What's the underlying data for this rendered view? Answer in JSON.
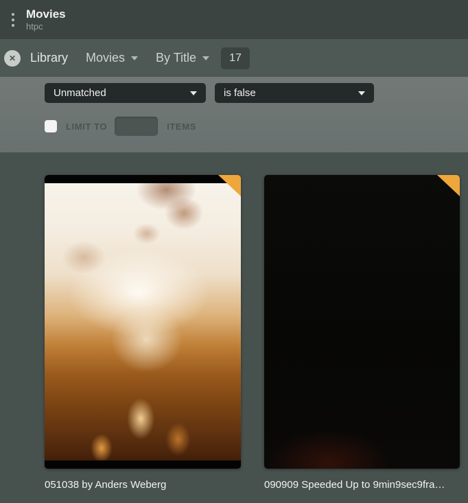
{
  "titlebar": {
    "title": "Movies",
    "subtitle": "htpc"
  },
  "nav": {
    "library_label": "Library",
    "type_dropdown_label": "Movies",
    "sort_dropdown_label": "By Title",
    "count_badge": "17"
  },
  "filters": {
    "field_value": "Unmatched",
    "operator_value": "is false",
    "limit_label": "LIMIT TO",
    "limit_value": "",
    "items_label": "ITEMS",
    "limit_checked": false
  },
  "grid": {
    "items": [
      {
        "title": "051038 by Anders Weberg",
        "unmatched": true
      },
      {
        "title": "090909 Speeded Up to 9min9sec9fra…",
        "unmatched": true
      }
    ]
  },
  "icons": {
    "close": "✕"
  },
  "colors": {
    "accent_orange": "#eea73b",
    "titlebar_bg": "#3c4441",
    "nav_bg": "#4e5855",
    "filter_panel_bg": "#6e7572",
    "content_bg": "#47514d",
    "dropdown_bg": "#242a29",
    "badge_bg": "#3b4440"
  }
}
